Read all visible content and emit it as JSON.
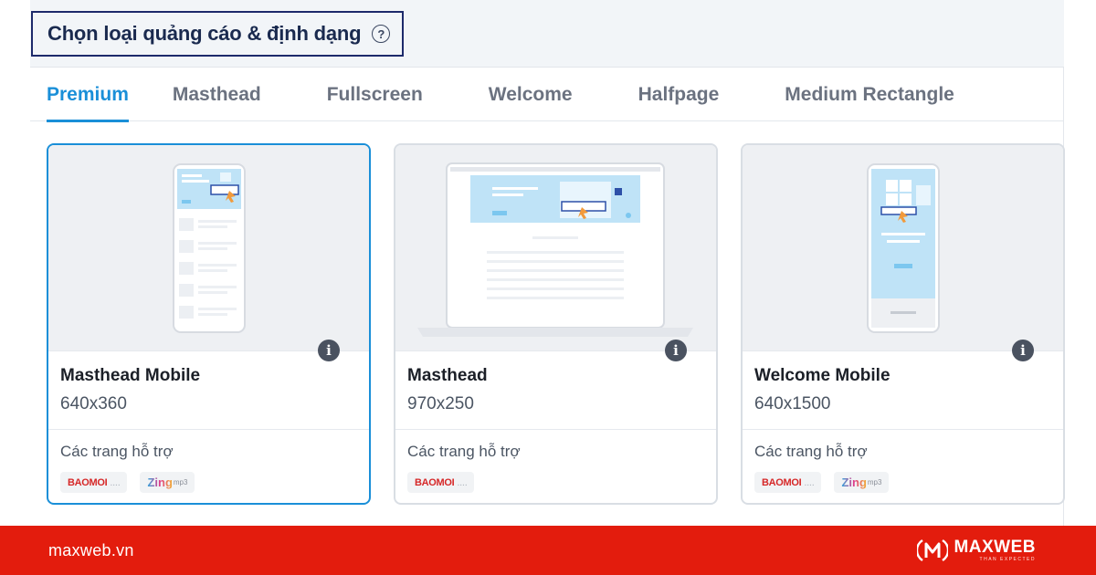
{
  "header": {
    "title": "Chọn loại quảng cáo & định dạng",
    "help_icon": "help-circle-icon"
  },
  "tabs": [
    {
      "label": "Premium",
      "active": true
    },
    {
      "label": "Masthead",
      "active": false
    },
    {
      "label": "Fullscreen",
      "active": false
    },
    {
      "label": "Welcome",
      "active": false
    },
    {
      "label": "Halfpage",
      "active": false
    },
    {
      "label": "Medium Rectangle",
      "active": false
    }
  ],
  "cards": [
    {
      "name": "Masthead Mobile",
      "size": "640x360",
      "support_label": "Các trang hỗ trợ",
      "badges": [
        "BAOMOI",
        "Zing mp3"
      ],
      "selected": true,
      "preview": "phone"
    },
    {
      "name": "Masthead",
      "size": "970x250",
      "support_label": "Các trang hỗ trợ",
      "badges": [
        "BAOMOI"
      ],
      "selected": false,
      "preview": "laptop"
    },
    {
      "name": "Welcome Mobile",
      "size": "640x1500",
      "support_label": "Các trang hỗ trợ",
      "badges": [
        "BAOMOI",
        "Zing mp3"
      ],
      "selected": false,
      "preview": "phone-full"
    }
  ],
  "badge_labels": {
    "baomoi": "BAOMOI",
    "baomoi_suffix": "....",
    "zing": "Zing",
    "zing_suffix": "mp3"
  },
  "footer": {
    "site": "maxweb.vn",
    "brand": "MAXWEB",
    "tagline": "THAN EXPECTED"
  },
  "colors": {
    "accent": "#1a8fd8",
    "footer_bg": "#e31c0d",
    "title_border": "#1d2a6b"
  }
}
